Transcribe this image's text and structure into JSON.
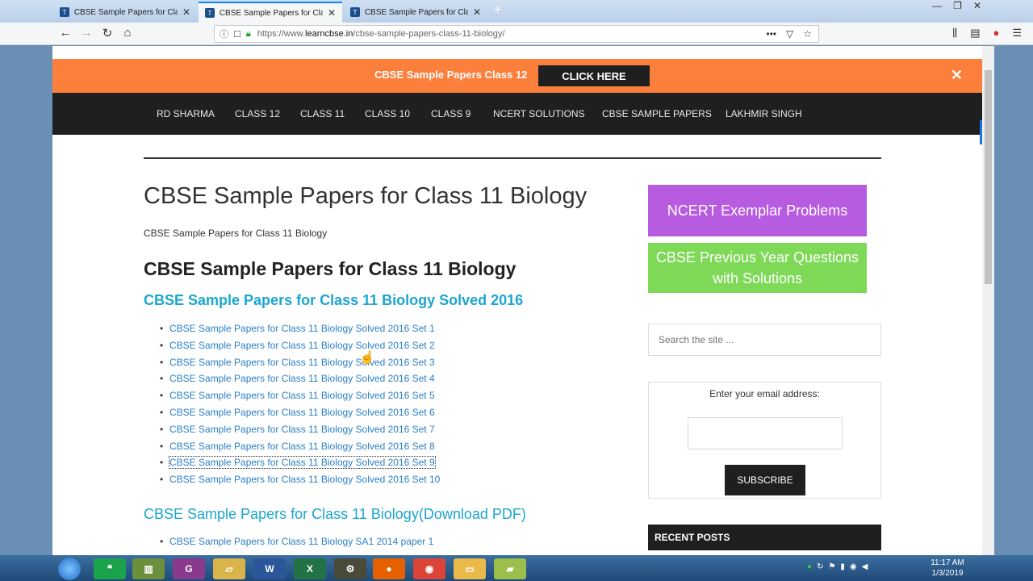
{
  "browser": {
    "tabs": [
      {
        "title": "CBSE Sample Papers for Class 1",
        "active": false
      },
      {
        "title": "CBSE Sample Papers for Class 1",
        "active": true
      },
      {
        "title": "CBSE Sample Papers for Class 1",
        "active": false
      }
    ],
    "url_prefix": "https://www.",
    "url_domain": "learncbse.in",
    "url_path": "/cbse-sample-papers-class-11-biology/"
  },
  "promo": {
    "text": "CBSE Sample Papers Class 12",
    "button": "CLICK HERE",
    "close": "✕"
  },
  "nav": [
    "RD SHARMA",
    "CLASS 12",
    "CLASS 11",
    "CLASS 10",
    "CLASS 9",
    "NCERT SOLUTIONS",
    "CBSE SAMPLE PAPERS",
    "LAKHMIR SINGH"
  ],
  "article": {
    "title": "CBSE Sample Papers for Class 11 Biology",
    "subtitle": "CBSE Sample Papers for Class 11 Biology",
    "heading": "CBSE Sample Papers for Class 11  Biology",
    "section1": "CBSE Sample Papers for Class 11  Biology Solved 2016",
    "links": [
      "CBSE Sample Papers for Class 11  Biology Solved 2016 Set 1",
      "CBSE Sample Papers for Class 11  Biology Solved 2016 Set 2",
      "CBSE Sample Papers for Class 11  Biology Solved 2016 Set 3",
      "CBSE Sample Papers for Class 11  Biology Solved 2016 Set 4",
      "CBSE Sample Papers for Class 11  Biology Solved 2016 Set 5",
      "CBSE Sample Papers for Class 11  Biology Solved 2016 Set 6",
      "CBSE Sample Papers for Class 11  Biology Solved 2016 Set 7",
      "CBSE Sample Papers for Class 11  Biology Solved 2016 Set 8",
      "CBSE Sample Papers for Class 11  Biology Solved 2016 Set 9",
      "CBSE Sample Papers for Class 11  Biology Solved 2016 Set 10"
    ],
    "section2": "CBSE Sample Papers for Class 11  Biology(Download PDF)",
    "links2": [
      "CBSE Sample Papers for Class 11 Biology SA1 2014 paper 1"
    ]
  },
  "sidebar": {
    "ncert": "NCERT Exemplar Problems",
    "previous": "CBSE Previous Year Questions with Solutions",
    "search_placeholder": "Search the site ...",
    "email_label": "Enter your email address:",
    "subscribe": "SUBSCRIBE",
    "recent": "RECENT POSTS"
  },
  "taskbar": {
    "time": "11:17 AM",
    "date": "1/3/2019"
  },
  "colors": {
    "promo": "#fc7f3c",
    "nav": "#1f1f1f",
    "link": "#2a7fc6",
    "heading_accent": "#1ba6cf",
    "purple": "#b75be0",
    "green": "#7ed957"
  }
}
